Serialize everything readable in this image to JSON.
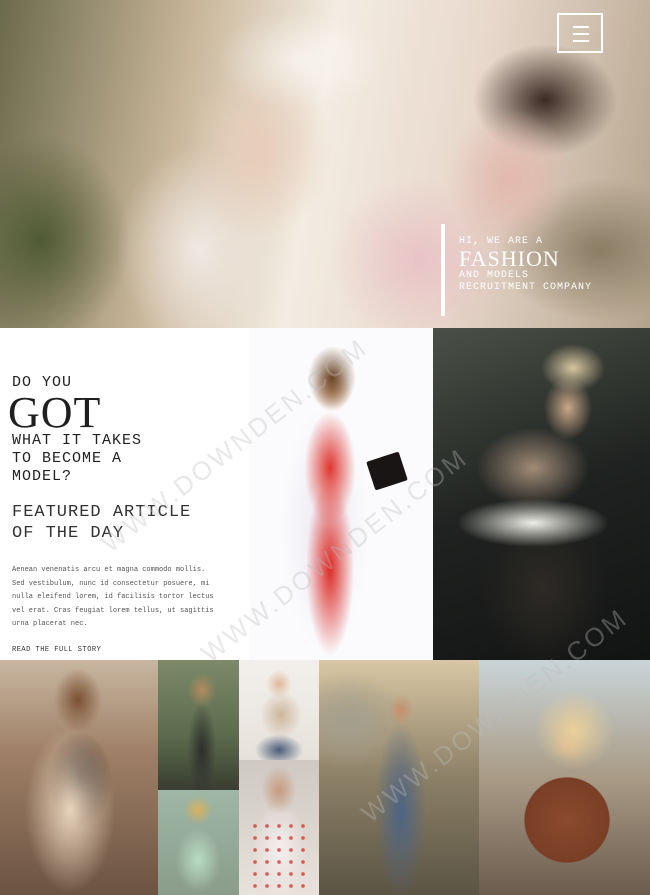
{
  "hero": {
    "line1": "HI, WE ARE A",
    "line2": "FASHION",
    "line3": "AND MODELS",
    "line4": "RECRUITMENT COMPANY"
  },
  "menu": {
    "icon": "hamburger-menu-icon"
  },
  "intro": {
    "do_you": "DO YOU",
    "got": "GOT",
    "line1": "WHAT IT TAKES",
    "line2": "TO BECOME A",
    "line3": "MODEL?"
  },
  "featured": {
    "line1": "FEATURED ARTICLE",
    "line2": "OF THE DAY",
    "body": [
      "Aenean venenatis arcu et magna commodo mollis.",
      "Sed vestibulum, nunc id consectetur posuere, mi",
      "nulla eleifend lorem, id facilisis tortor lectus",
      "vel erat. Cras feugiat lorem tellus, ut sagittis",
      "urna placerat nec."
    ],
    "read_more": "READ THE FULL STORY"
  },
  "watermark": "WWW.DOWNDEN.COM",
  "colors": {
    "text_dark": "#222222",
    "body_text": "#555555",
    "hero_text": "#ffffff"
  }
}
